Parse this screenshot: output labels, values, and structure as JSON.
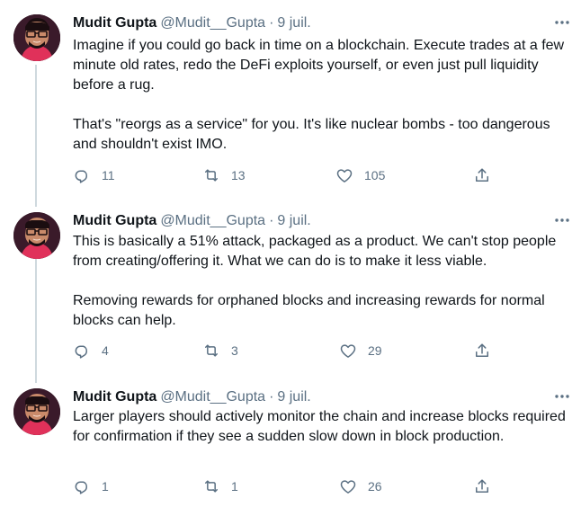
{
  "tweets": [
    {
      "author": "Mudit Gupta",
      "handle": "@Mudit__Gupta",
      "separator": "·",
      "date": "9 juil.",
      "text": [
        "Imagine if you could go back in time on a blockchain. Execute trades at a few minute old rates, redo the DeFi exploits yourself, or even just pull liquidity before a rug.",
        "That's \"reorgs as a service\" for you. It's like nuclear bombs - too dangerous and shouldn't exist IMO."
      ],
      "replies": "11",
      "retweets": "13",
      "likes": "105"
    },
    {
      "author": "Mudit Gupta",
      "handle": "@Mudit__Gupta",
      "separator": "·",
      "date": "9 juil.",
      "text": [
        "This is basically a 51% attack, packaged as a product. We can't stop people from creating/offering it. What we can do is to make it less viable.",
        "Removing rewards for orphaned blocks and increasing rewards for normal blocks can help."
      ],
      "replies": "4",
      "retweets": "3",
      "likes": "29"
    },
    {
      "author": "Mudit Gupta",
      "handle": "@Mudit__Gupta",
      "separator": "·",
      "date": "9 juil.",
      "text": [
        "Larger players should actively monitor the chain and increase blocks required for confirmation if they see a sudden slow down in block production."
      ],
      "replies": "1",
      "retweets": "1",
      "likes": "26"
    }
  ],
  "icons": {
    "more": "more-icon",
    "reply": "reply-icon",
    "retweet": "retweet-icon",
    "like": "heart-icon",
    "share": "share-icon"
  },
  "colors": {
    "text_primary": "#0f1419",
    "text_secondary": "#5b7083",
    "thread_line": "#cfd9de",
    "avatar_background": "#2a1420"
  }
}
